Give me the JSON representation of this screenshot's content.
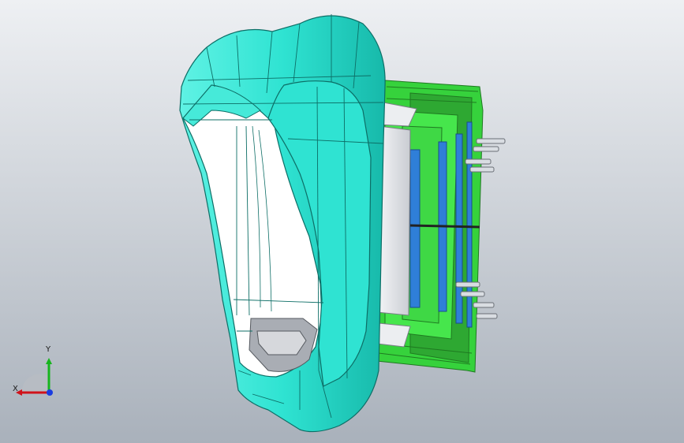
{
  "viewport": {
    "background_top": "#eef0f3",
    "background_bottom": "#a9b1bb"
  },
  "model": {
    "parts": [
      "cyan-shell",
      "green-frame",
      "blue-inserts",
      "grey-core",
      "pins"
    ],
    "colors": {
      "shell": "#2fe3d2",
      "shell_dark": "#12a99b",
      "frame": "#3ee044",
      "frame_dark": "#2a9a2c",
      "insert": "#2f7fd8",
      "core": "#e6e8ec",
      "pin": "#d9dde2"
    }
  },
  "triad": {
    "x_label": "X",
    "y_label": "Y",
    "x_color": "#d0121a",
    "y_color": "#17b51e",
    "z_color": "#1a3ce0"
  }
}
